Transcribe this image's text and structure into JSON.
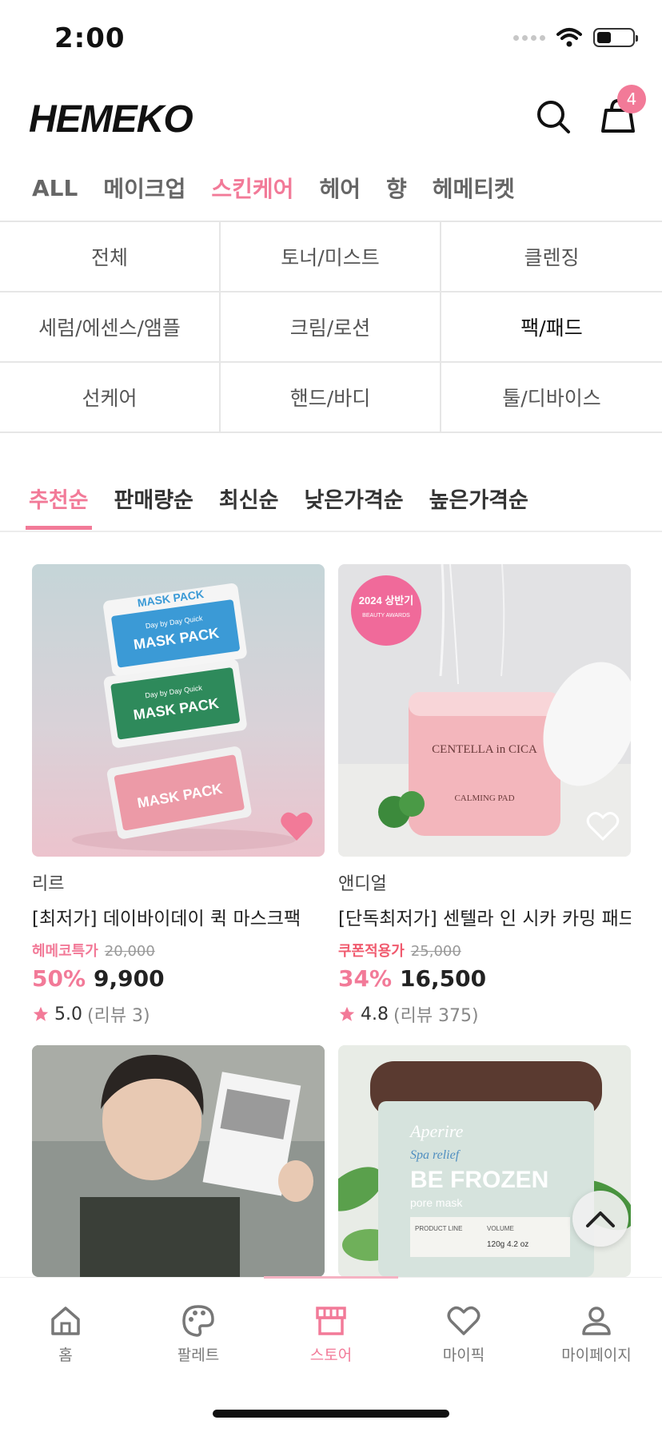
{
  "status_bar": {
    "time": "2:00"
  },
  "header": {
    "logo": "HEMEKO",
    "cart_count": "4"
  },
  "category_tabs": [
    {
      "label": "ALL",
      "active": false
    },
    {
      "label": "메이크업",
      "active": false
    },
    {
      "label": "스킨케어",
      "active": true
    },
    {
      "label": "헤어",
      "active": false
    },
    {
      "label": "향",
      "active": false
    },
    {
      "label": "헤메티켓",
      "active": false
    }
  ],
  "subcategories": [
    {
      "label": "전체"
    },
    {
      "label": "토너/미스트"
    },
    {
      "label": "클렌징"
    },
    {
      "label": "세럼/에센스/앰플"
    },
    {
      "label": "크림/로션"
    },
    {
      "label": "팩/패드",
      "selected": true
    },
    {
      "label": "선케어"
    },
    {
      "label": "핸드/바디"
    },
    {
      "label": "툴/디바이스"
    }
  ],
  "sort_tabs": [
    {
      "label": "추천순",
      "active": true
    },
    {
      "label": "판매량순"
    },
    {
      "label": "최신순"
    },
    {
      "label": "낮은가격순"
    },
    {
      "label": "높은가격순"
    }
  ],
  "products": [
    {
      "brand": "리르",
      "name": "[최저가] 데이바이데이 퀵 마스크팩",
      "promo_label": "헤메코특가",
      "original_price": "20,000",
      "discount": "50%",
      "price": "9,900",
      "rating": "5.0",
      "reviews": "(리뷰 3)",
      "liked": true,
      "image_texts": [
        "MASK PACK",
        "Day by Day Quick",
        "MASK PACK",
        "Day by Day Quick",
        "MASK PACK"
      ]
    },
    {
      "brand": "앤디얼",
      "name": "[단독최저가] 센텔라 인 시카 카밍 패드",
      "promo_label": "쿠폰적용가",
      "original_price": "25,000",
      "discount": "34%",
      "price": "16,500",
      "rating": "4.8",
      "reviews": "(리뷰 375)",
      "liked": false,
      "image_texts": [
        "2024 상반기",
        "BEAUTY AWARDS",
        "CENTELLA in CICA",
        "CALMING PAD"
      ]
    },
    {
      "brand": "",
      "name": ""
    },
    {
      "brand": "",
      "name": "",
      "image_texts": [
        "Aperire",
        "Spa relief",
        "BE FROZEN",
        "pore mask",
        "PRODUCT LINE",
        "VOLUME",
        "120g  4.2 oz"
      ]
    }
  ],
  "bottom_nav": [
    {
      "label": "홈",
      "icon": "home-icon"
    },
    {
      "label": "팔레트",
      "icon": "palette-icon"
    },
    {
      "label": "스토어",
      "icon": "store-icon",
      "active": true
    },
    {
      "label": "마이픽",
      "icon": "heart-icon"
    },
    {
      "label": "마이페이지",
      "icon": "person-icon"
    }
  ],
  "colors": {
    "accent": "#f27a98",
    "coupon": "#f05a6e"
  }
}
